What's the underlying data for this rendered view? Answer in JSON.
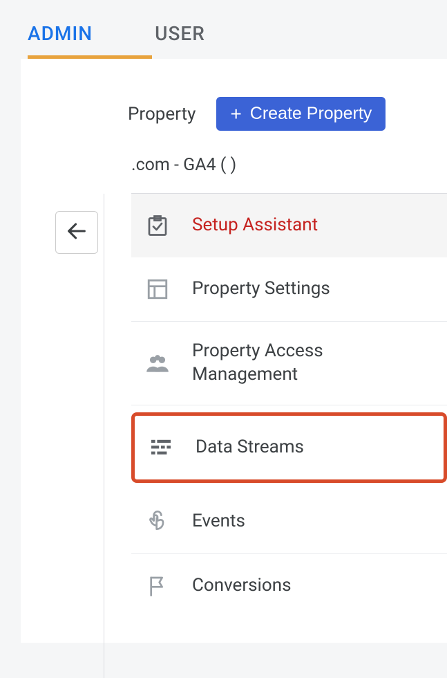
{
  "tabs": {
    "admin": "ADMIN",
    "user": "USER"
  },
  "property": {
    "label": "Property",
    "create_label": "Create Property",
    "name": ".com - GA4 (               )"
  },
  "menu": {
    "setup_assistant": "Setup Assistant",
    "property_settings": "Property Settings",
    "property_access": "Property Access Management",
    "data_streams": "Data Streams",
    "events": "Events",
    "conversions": "Conversions"
  }
}
